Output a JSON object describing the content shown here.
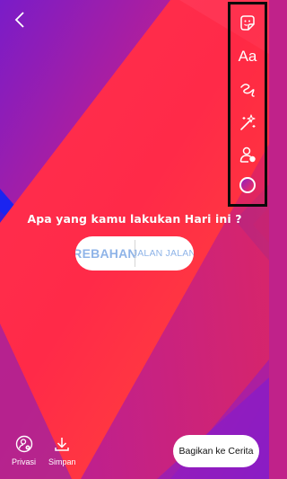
{
  "header": {
    "back_icon": "chevron-left-icon"
  },
  "toolbar": {
    "tools": [
      {
        "name": "sticker",
        "icon": "sticker-icon"
      },
      {
        "name": "text",
        "icon": "text-icon",
        "label": "Aa"
      },
      {
        "name": "draw",
        "icon": "scribble-icon"
      },
      {
        "name": "effects",
        "icon": "magic-wand-icon"
      },
      {
        "name": "mention",
        "icon": "add-person-icon"
      },
      {
        "name": "color",
        "icon": "color-circle-icon"
      }
    ],
    "highlight_color": "#0a0a0a"
  },
  "poll": {
    "question": "Apa yang kamu lakukan Hari ini ?",
    "option_a": "REBAHAN",
    "option_b": "JALAN JALAN",
    "text_color": "#8fb4e8"
  },
  "bottom": {
    "privacy_label": "Privasi",
    "save_label": "Simpan",
    "share_label": "Bagikan ke Cerita"
  },
  "colors": {
    "background_primary": "#ff2d4a",
    "background_secondary": "#8a1ec8",
    "accent_blue": "#1a2cf0"
  }
}
